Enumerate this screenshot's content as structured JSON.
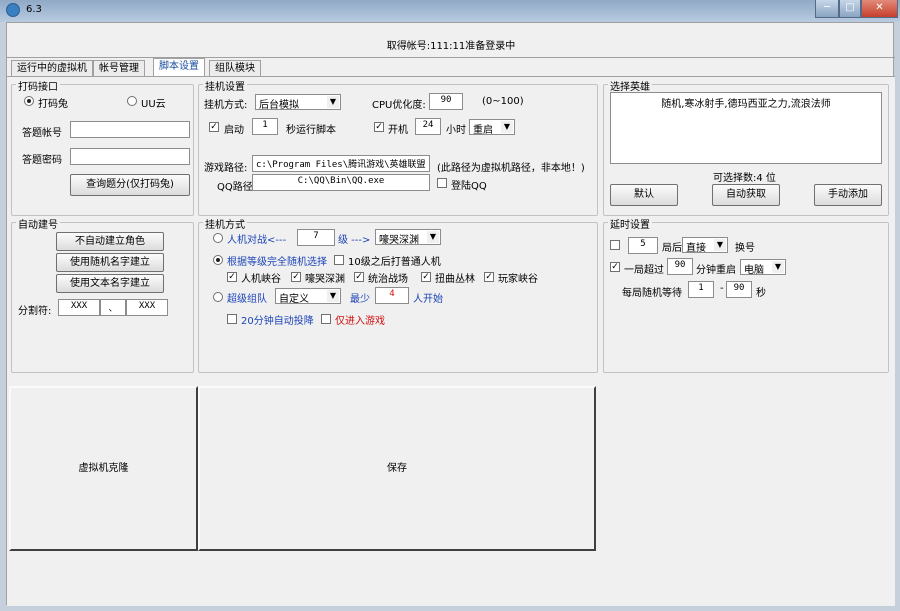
{
  "window": {
    "title": "6.3",
    "min_label": "─",
    "max_label": "□",
    "close_label": "✕"
  },
  "status_text": "取得帐号:111:11准备登录中",
  "tabs": [
    "运行中的虚拟机",
    "帐号管理",
    "脚本设置",
    "组队模块"
  ],
  "captcha": {
    "title": "打码接口",
    "opt1": "打码兔",
    "opt2": "UU云",
    "account_label": "答题帐号",
    "account_value": "",
    "password_label": "答题密码",
    "password_value": "",
    "query_button": "查询题分(仅打码兔)"
  },
  "hang": {
    "title": "挂机设置",
    "mode_label": "挂机方式:",
    "mode_value": "后台模拟",
    "cpu_label": "CPU优化度:",
    "cpu_value": "90",
    "cpu_range": "(0~100)",
    "start_label": "启动",
    "start_value": "1",
    "start_suffix": "秒运行脚本",
    "boot_label": "开机",
    "boot_value": "24",
    "boot_unit": "小时",
    "restart_value": "重启",
    "game_path_label": "游戏路径:",
    "game_path_value": "c:\\Program Files\\腾讯游戏\\英雄联盟",
    "path_note": "(此路径为虚拟机路径，非本地！)",
    "qq_path_label": "QQ路径:",
    "qq_path_value": "C:\\QQ\\Bin\\QQ.exe",
    "qq_login_label": "登陆QQ"
  },
  "hero": {
    "title": "选择英雄",
    "list_text": "随机,寒冰射手,德玛西亚之力,流浪法师",
    "count_text": "可选择数:4 位",
    "default_button": "默认",
    "auto_button": "自动获取",
    "manual_button": "手动添加"
  },
  "autocreate": {
    "title": "自动建号",
    "btn1": "不自动建立角色",
    "btn2": "使用随机名字建立",
    "btn3": "使用文本名字建立",
    "separator_label": "分割符:",
    "sep_left": "XXX",
    "sep_mid": "、",
    "sep_right": "XXX"
  },
  "hangmode": {
    "title": "挂机方式",
    "ai_label": "人机对战<---",
    "ai_level": "7",
    "ai_mid": "级 --->",
    "ai_map": "嚎哭深渊",
    "grade_label": "根据等级完全随机选择",
    "after10_label": "10级之后打普通人机",
    "map1": "人机峡谷",
    "map2": "嚎哭深渊",
    "map3": "统治战场",
    "map4": "扭曲丛林",
    "map5": "玩家峡谷",
    "team_label": "超级组队",
    "team_value": "自定义",
    "min_label": "最少",
    "min_value": "4",
    "start_label": "人开始",
    "surrender_label": "20分钟自动投降",
    "only_enter_label": "仅进入游戏"
  },
  "timer": {
    "title": "延时设置",
    "games_value": "5",
    "games_after": "局后",
    "games_action": "直接",
    "games_suffix": "换号",
    "over_label": "一局超过",
    "over_value": "90",
    "over_unit": "分钟重启",
    "over_target": "电脑",
    "rand_label": "每局随机等待",
    "rand_from": "1",
    "rand_dash": "-",
    "rand_to": "90",
    "rand_unit": "秒"
  },
  "bottom": {
    "clone_button": "虚拟机克隆",
    "save_button": "保存"
  }
}
